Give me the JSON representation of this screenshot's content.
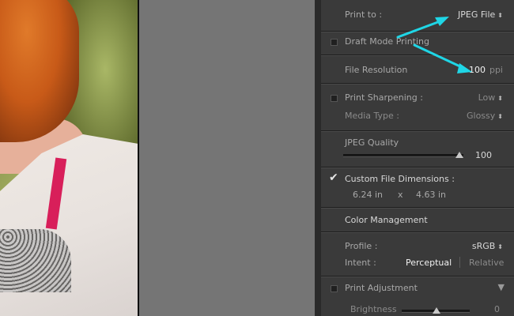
{
  "print_to": {
    "label": "Print to :",
    "value": "JPEG File"
  },
  "draft_mode": {
    "label": "Draft Mode Printing"
  },
  "file_resolution": {
    "label": "File Resolution",
    "value": "100",
    "unit": "ppi"
  },
  "sharpening": {
    "label": "Print Sharpening :",
    "value": "Low",
    "media_label": "Media Type :",
    "media_value": "Glossy"
  },
  "jpeg_quality": {
    "label": "JPEG Quality",
    "value": "100",
    "level": 1.0
  },
  "custom_dimensions": {
    "label": "Custom File Dimensions :",
    "width": "6.24 in",
    "x": "x",
    "height": "4.63 in"
  },
  "color_management": {
    "header": "Color Management",
    "profile_label": "Profile :",
    "profile_value": "sRGB",
    "intent_label": "Intent :",
    "intent_perceptual": "Perceptual",
    "intent_relative": "Relative"
  },
  "print_adjustment": {
    "label": "Print Adjustment",
    "brightness_label": "Brightness",
    "brightness_value": "0"
  },
  "colors": {
    "arrow": "#1fd6e6",
    "panel_bg": "#3a3a3a"
  }
}
